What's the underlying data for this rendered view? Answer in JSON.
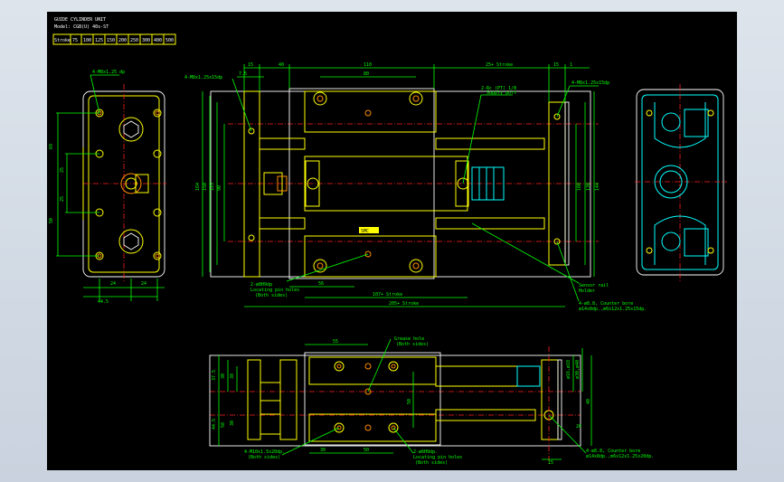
{
  "title_block": {
    "line1": "GUIDE CYLINDER UNIT",
    "line2": "Model: CGB(U) 40s-ST",
    "stroke_label": "Stroke",
    "strokes": [
      "75",
      "100",
      "125",
      "150",
      "200",
      "250",
      "300",
      "400",
      "500"
    ]
  },
  "notes": {
    "front_holes": "4-M8x1.25 dp",
    "top_tap": "4-M8x1.25x15dp",
    "port": "2-Rc (PT) 1/8",
    "port_sub": "Supply port",
    "right_tap": "4-M8x1.25x15dp",
    "locating_pin": "2-ø8H9dp",
    "locating_pin_sub1": "Locating pin holes",
    "locating_pin_sub2": "(Both sides)",
    "counter_bore": "4-ø8.8, Counter bore",
    "counter_bore_sub": "ø14x8dp.,m6x12x1.25x15dp.",
    "sensor_hook": "Sensor rail",
    "sensor_sub": "Holder",
    "side_bore": "4-ø8.8, Counter bore",
    "side_bore_sub": "ø14x8dp.,m6x12x1.25x20dp.",
    "bottom_tap": "4-M10x1.5x20dp.",
    "bottom_tap_sub": "(Both sides)",
    "bottom_pin": "2-ø6H9dp.",
    "bottom_pin_sub1": "Locating pin holes",
    "bottom_pin_sub2": "(Both sides)",
    "bottom_top": "Grease hole",
    "bottom_top_sub": "(Both sides)",
    "plate": "SMC"
  },
  "dims": {
    "d15": "15",
    "d40": "40",
    "d110": "110",
    "d25stroke": "25+ Stroke",
    "d15b": "15",
    "d1": "1",
    "d7_5": "7.5",
    "d80": "80",
    "d56": "56",
    "d107stroke": "107+ Stroke",
    "d205stroke": "205+ Stroke",
    "d164": "164",
    "d150": "150",
    "d125": "125",
    "d90": "90",
    "d100": "100",
    "d130": "130",
    "d144": "144",
    "d69": "69",
    "d25": "25",
    "d25b": "25",
    "d50": "50",
    "d44_5": "44.5",
    "d24": "24",
    "d24b": "24",
    "d55": "55",
    "d37_5": "37.5",
    "d30": "30",
    "d38": "38",
    "d44_5b": "44.5",
    "d58": "58",
    "d30b": "30",
    "d50b": "50",
    "d30c": "30",
    "d50c": "50",
    "d20": "20",
    "d15c": "15",
    "d40b": "40",
    "rod_dim": "ø16,ø18",
    "rod_dim2": "ø30,ø40"
  }
}
